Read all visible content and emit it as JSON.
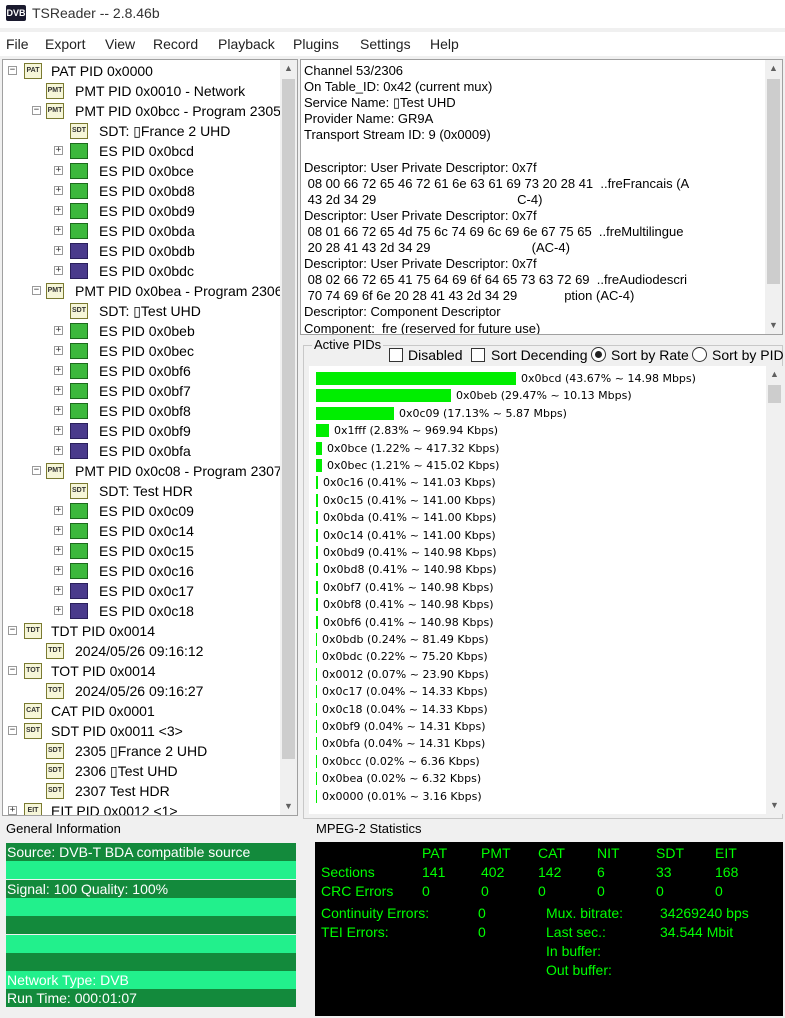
{
  "window": {
    "icon_text": "DVB",
    "title": "TSReader -- 2.8.46b"
  },
  "menu": [
    "File",
    "Export",
    "View",
    "Record",
    "Playback",
    "Plugins",
    "Settings",
    "Help"
  ],
  "tree": [
    {
      "label": "PAT PID 0x0000",
      "icon": "PAT",
      "level": 0,
      "expander": "−"
    },
    {
      "label": "PMT PID 0x0010 - Network",
      "icon": "PMT",
      "level": 1,
      "expander": ""
    },
    {
      "label": "PMT PID 0x0bcc - Program 2305",
      "icon": "PMT",
      "level": 1,
      "expander": "−"
    },
    {
      "label": "SDT: ▯France 2 UHD",
      "icon": "SDT",
      "level": 2,
      "expander": ""
    },
    {
      "label": "ES PID 0x0bcd",
      "icon": "es",
      "level": 2,
      "expander": "+"
    },
    {
      "label": "ES PID 0x0bce",
      "icon": "es",
      "level": 2,
      "expander": "+"
    },
    {
      "label": "ES PID 0x0bd8",
      "icon": "es",
      "level": 2,
      "expander": "+"
    },
    {
      "label": "ES PID 0x0bd9",
      "icon": "es",
      "level": 2,
      "expander": "+"
    },
    {
      "label": "ES PID 0x0bda",
      "icon": "es",
      "level": 2,
      "expander": "+"
    },
    {
      "label": "ES PID 0x0bdb",
      "icon": "esv",
      "level": 2,
      "expander": "+"
    },
    {
      "label": "ES PID 0x0bdc",
      "icon": "esv",
      "level": 2,
      "expander": "+"
    },
    {
      "label": "PMT PID 0x0bea - Program 2306",
      "icon": "PMT",
      "level": 1,
      "expander": "−"
    },
    {
      "label": "SDT: ▯Test UHD",
      "icon": "SDT",
      "level": 2,
      "expander": ""
    },
    {
      "label": "ES PID 0x0beb",
      "icon": "es",
      "level": 2,
      "expander": "+"
    },
    {
      "label": "ES PID 0x0bec",
      "icon": "es",
      "level": 2,
      "expander": "+"
    },
    {
      "label": "ES PID 0x0bf6",
      "icon": "es",
      "level": 2,
      "expander": "+"
    },
    {
      "label": "ES PID 0x0bf7",
      "icon": "es",
      "level": 2,
      "expander": "+"
    },
    {
      "label": "ES PID 0x0bf8",
      "icon": "es",
      "level": 2,
      "expander": "+"
    },
    {
      "label": "ES PID 0x0bf9",
      "icon": "esv",
      "level": 2,
      "expander": "+"
    },
    {
      "label": "ES PID 0x0bfa",
      "icon": "esv",
      "level": 2,
      "expander": "+"
    },
    {
      "label": "PMT PID 0x0c08 - Program 2307",
      "icon": "PMT",
      "level": 1,
      "expander": "−"
    },
    {
      "label": "SDT: Test HDR",
      "icon": "SDT",
      "level": 2,
      "expander": ""
    },
    {
      "label": "ES PID 0x0c09",
      "icon": "es",
      "level": 2,
      "expander": "+"
    },
    {
      "label": "ES PID 0x0c14",
      "icon": "es",
      "level": 2,
      "expander": "+"
    },
    {
      "label": "ES PID 0x0c15",
      "icon": "es",
      "level": 2,
      "expander": "+"
    },
    {
      "label": "ES PID 0x0c16",
      "icon": "es",
      "level": 2,
      "expander": "+"
    },
    {
      "label": "ES PID 0x0c17",
      "icon": "esv",
      "level": 2,
      "expander": "+"
    },
    {
      "label": "ES PID 0x0c18",
      "icon": "esv",
      "level": 2,
      "expander": "+"
    },
    {
      "label": "TDT PID 0x0014",
      "icon": "TDT",
      "level": 0,
      "expander": "−"
    },
    {
      "label": "2024/05/26 09:16:12",
      "icon": "TDT",
      "level": 1,
      "expander": ""
    },
    {
      "label": "TOT PID 0x0014",
      "icon": "TOT",
      "level": 0,
      "expander": "−"
    },
    {
      "label": "2024/05/26 09:16:27",
      "icon": "TOT",
      "level": 1,
      "expander": ""
    },
    {
      "label": "CAT PID 0x0001",
      "icon": "CAT",
      "level": 0,
      "expander": ""
    },
    {
      "label": "SDT PID 0x0011 <3>",
      "icon": "SDT",
      "level": 0,
      "expander": "−"
    },
    {
      "label": "2305 ▯France 2 UHD",
      "icon": "SDT",
      "level": 1,
      "expander": ""
    },
    {
      "label": "2306 ▯Test UHD",
      "icon": "SDT",
      "level": 1,
      "expander": ""
    },
    {
      "label": "2307 Test HDR",
      "icon": "SDT",
      "level": 1,
      "expander": ""
    },
    {
      "label": "EIT PID 0x0012 <1>",
      "icon": "EIT",
      "level": 0,
      "expander": "+"
    }
  ],
  "detail_text": "Channel 53/2306\nOn Table_ID: 0x42 (current mux)\nService Name: ▯Test UHD\nProvider Name: GR9A\nTransport Stream ID: 9 (0x0009)\n\nDescriptor: User Private Descriptor: 0x7f\n 08 00 66 72 65 46 72 61 6e 63 61 69 73 20 28 41  ..freFrancais (A\n 43 2d 34 29                                       C-4)\nDescriptor: User Private Descriptor: 0x7f\n 08 01 66 72 65 4d 75 6c 74 69 6c 69 6e 67 75 65  ..freMultilingue\n 20 28 41 43 2d 34 29                            (AC-4)\nDescriptor: User Private Descriptor: 0x7f\n 08 02 66 72 65 41 75 64 69 6f 64 65 73 63 72 69  ..freAudiodescri\n 70 74 69 6f 6e 20 28 41 43 2d 34 29             ption (AC-4)\nDescriptor: Component Descriptor\nComponent:  fre (reserved for future use)",
  "active_pids": {
    "title": "Active PIDs",
    "options": {
      "disabled": "Disabled",
      "sort_desc": "Sort Decending",
      "sort_rate": "Sort by Rate",
      "sort_pid": "Sort by PID"
    },
    "rows": [
      {
        "text": "0x0bcd (43.67% ~ 14.98 Mbps)",
        "pct": 43.67
      },
      {
        "text": "0x0beb (29.47% ~ 10.13 Mbps)",
        "pct": 29.47
      },
      {
        "text": "0x0c09 (17.13% ~ 5.87 Mbps)",
        "pct": 17.13
      },
      {
        "text": "0x1fff (2.83% ~ 969.94 Kbps)",
        "pct": 2.83
      },
      {
        "text": "0x0bce (1.22% ~ 417.32 Kbps)",
        "pct": 1.22
      },
      {
        "text": "0x0bec (1.21% ~ 415.02 Kbps)",
        "pct": 1.21
      },
      {
        "text": "0x0c16 (0.41% ~ 141.03 Kbps)",
        "pct": 0.41
      },
      {
        "text": "0x0c15 (0.41% ~ 141.00 Kbps)",
        "pct": 0.41
      },
      {
        "text": "0x0bda (0.41% ~ 141.00 Kbps)",
        "pct": 0.41
      },
      {
        "text": "0x0c14 (0.41% ~ 141.00 Kbps)",
        "pct": 0.41
      },
      {
        "text": "0x0bd9 (0.41% ~ 140.98 Kbps)",
        "pct": 0.41
      },
      {
        "text": "0x0bd8 (0.41% ~ 140.98 Kbps)",
        "pct": 0.41
      },
      {
        "text": "0x0bf7 (0.41% ~ 140.98 Kbps)",
        "pct": 0.41
      },
      {
        "text": "0x0bf8 (0.41% ~ 140.98 Kbps)",
        "pct": 0.41
      },
      {
        "text": "0x0bf6 (0.41% ~ 140.98 Kbps)",
        "pct": 0.41
      },
      {
        "text": "0x0bdb (0.24% ~ 81.49 Kbps)",
        "pct": 0.24
      },
      {
        "text": "0x0bdc (0.22% ~ 75.20 Kbps)",
        "pct": 0.22
      },
      {
        "text": "0x0012 (0.07% ~ 23.90 Kbps)",
        "pct": 0.07
      },
      {
        "text": "0x0c17 (0.04% ~ 14.33 Kbps)",
        "pct": 0.04
      },
      {
        "text": "0x0c18 (0.04% ~ 14.33 Kbps)",
        "pct": 0.04
      },
      {
        "text": "0x0bf9 (0.04% ~ 14.31 Kbps)",
        "pct": 0.04
      },
      {
        "text": "0x0bfa (0.04% ~ 14.31 Kbps)",
        "pct": 0.04
      },
      {
        "text": "0x0bcc (0.02% ~ 6.36 Kbps)",
        "pct": 0.02
      },
      {
        "text": "0x0bea (0.02% ~ 6.32 Kbps)",
        "pct": 0.02
      },
      {
        "text": "0x0000 (0.01% ~ 3.16 Kbps)",
        "pct": 0.01
      }
    ]
  },
  "general_info": {
    "title": "General Information",
    "lines": [
      "Source: DVB-T BDA compatible source",
      "",
      "Signal: 100 Quality: 100%",
      "",
      "",
      "",
      "",
      "Network Type: DVB",
      "Run Time: 000:01:07"
    ]
  },
  "mpeg_stats": {
    "title": "MPEG-2 Statistics",
    "columns": [
      "PAT",
      "PMT",
      "CAT",
      "NIT",
      "SDT",
      "EIT"
    ],
    "sections_label": "Sections",
    "sections": [
      "141",
      "402",
      "142",
      "6",
      "33",
      "168"
    ],
    "crc_label": "CRC Errors",
    "crc": [
      "0",
      "0",
      "0",
      "0",
      "0",
      "0"
    ],
    "cont_label": "Continuity Errors:",
    "cont_value": "0",
    "tei_label": "TEI Errors:",
    "tei_value": "0",
    "mux_label": "Mux. bitrate:",
    "mux_value": "34269240 bps",
    "last_label": "Last sec.:",
    "last_value": "34.544 Mbit",
    "inbuf_label": "In buffer:",
    "outbuf_label": "Out buffer:"
  },
  "colors": {
    "bar_green": "#00ee00",
    "info_light": "#22f08c",
    "info_dark": "#138a3c",
    "stats_text": "#00ff00"
  }
}
